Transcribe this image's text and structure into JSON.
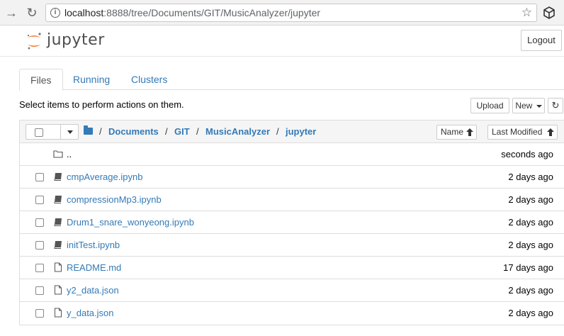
{
  "browser": {
    "url_host": "localhost",
    "url_path": ":8888/tree/Documents/GIT/MusicAnalyzer/jupyter"
  },
  "header": {
    "logo_text": "jupyter",
    "logout_label": "Logout"
  },
  "tabs": [
    {
      "label": "Files",
      "active": true
    },
    {
      "label": "Running",
      "active": false
    },
    {
      "label": "Clusters",
      "active": false
    }
  ],
  "toolbar": {
    "select_message": "Select items to perform actions on them.",
    "upload_label": "Upload",
    "new_label": "New"
  },
  "breadcrumb": [
    {
      "label": "Documents"
    },
    {
      "label": "GIT"
    },
    {
      "label": "MusicAnalyzer"
    },
    {
      "label": "jupyter"
    }
  ],
  "breadcrumb_separator": "/",
  "sort": {
    "name_label": "Name",
    "modified_label": "Last Modified"
  },
  "files": [
    {
      "name": "..",
      "type": "folder",
      "modified": "seconds ago",
      "checkbox": false
    },
    {
      "name": "cmpAverage.ipynb",
      "type": "notebook",
      "modified": "2 days ago",
      "checkbox": true
    },
    {
      "name": "compressionMp3.ipynb",
      "type": "notebook",
      "modified": "2 days ago",
      "checkbox": true
    },
    {
      "name": "Drum1_snare_wonyeong.ipynb",
      "type": "notebook",
      "modified": "2 days ago",
      "checkbox": true
    },
    {
      "name": "initTest.ipynb",
      "type": "notebook",
      "modified": "2 days ago",
      "checkbox": true
    },
    {
      "name": "README.md",
      "type": "file",
      "modified": "17 days ago",
      "checkbox": true
    },
    {
      "name": "y2_data.json",
      "type": "file",
      "modified": "2 days ago",
      "checkbox": true
    },
    {
      "name": "y_data.json",
      "type": "file",
      "modified": "2 days ago",
      "checkbox": true
    }
  ],
  "colors": {
    "link": "#337ab7",
    "logo_orange": "#f37726"
  }
}
